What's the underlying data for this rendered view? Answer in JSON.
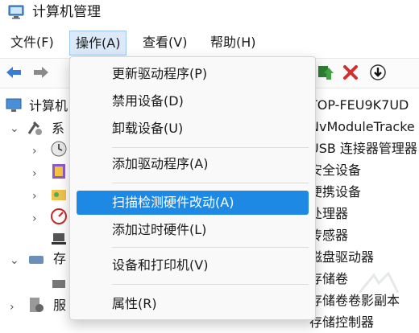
{
  "window": {
    "title": "计算机管理"
  },
  "menubar": [
    {
      "label": "文件(F)"
    },
    {
      "label": "操作(A)"
    },
    {
      "label": "查看(V)"
    },
    {
      "label": "帮助(H)"
    }
  ],
  "dropdown": {
    "items": [
      {
        "label": "更新驱动程序(P)"
      },
      {
        "label": "禁用设备(D)"
      },
      {
        "label": "卸载设备(U)"
      },
      {
        "label": "添加驱动程序(A)"
      },
      {
        "label": "扫描检测硬件改动(A)",
        "highlighted": true
      },
      {
        "label": "添加过时硬件(L)"
      },
      {
        "label": "设备和打印机(V)"
      },
      {
        "label": "属性(R)"
      }
    ]
  },
  "tree": {
    "root": "计算机",
    "system": "系",
    "storage": "存",
    "services": "服"
  },
  "devices": [
    "TOP-FEU9K7UD",
    "NvModuleTracke",
    "USB 连接器管理器",
    "安全设备",
    "便携设备",
    "处理器",
    "传感器",
    "磁盘驱动器",
    "存储卷",
    "存储卷卷影副本",
    "存储控制器"
  ],
  "colors": {
    "accent": "#1e88e5",
    "menu_active_bg": "#dbe9f8",
    "delete_red": "#d32f2f"
  }
}
